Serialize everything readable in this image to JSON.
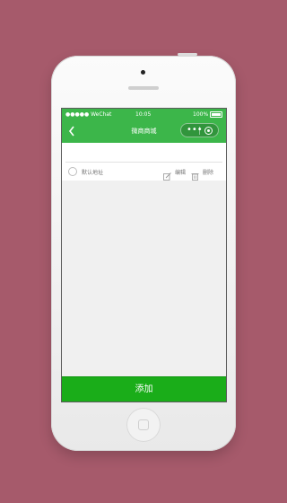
{
  "status_bar": {
    "carrier": "●●●●● WeChat",
    "time": "10:05",
    "battery_text": "100%"
  },
  "nav": {
    "title": "微商商城",
    "back_icon": "chevron-left-icon",
    "more_icon": "more-dots-icon",
    "close_icon": "target-icon"
  },
  "address_item": {
    "default_label": "默认地址",
    "edit_label": "编辑",
    "delete_label": "删除"
  },
  "footer": {
    "add_label": "添加"
  },
  "colors": {
    "brand_green": "#3cb64a",
    "button_green": "#1aad19",
    "background": "#a65a6b"
  }
}
